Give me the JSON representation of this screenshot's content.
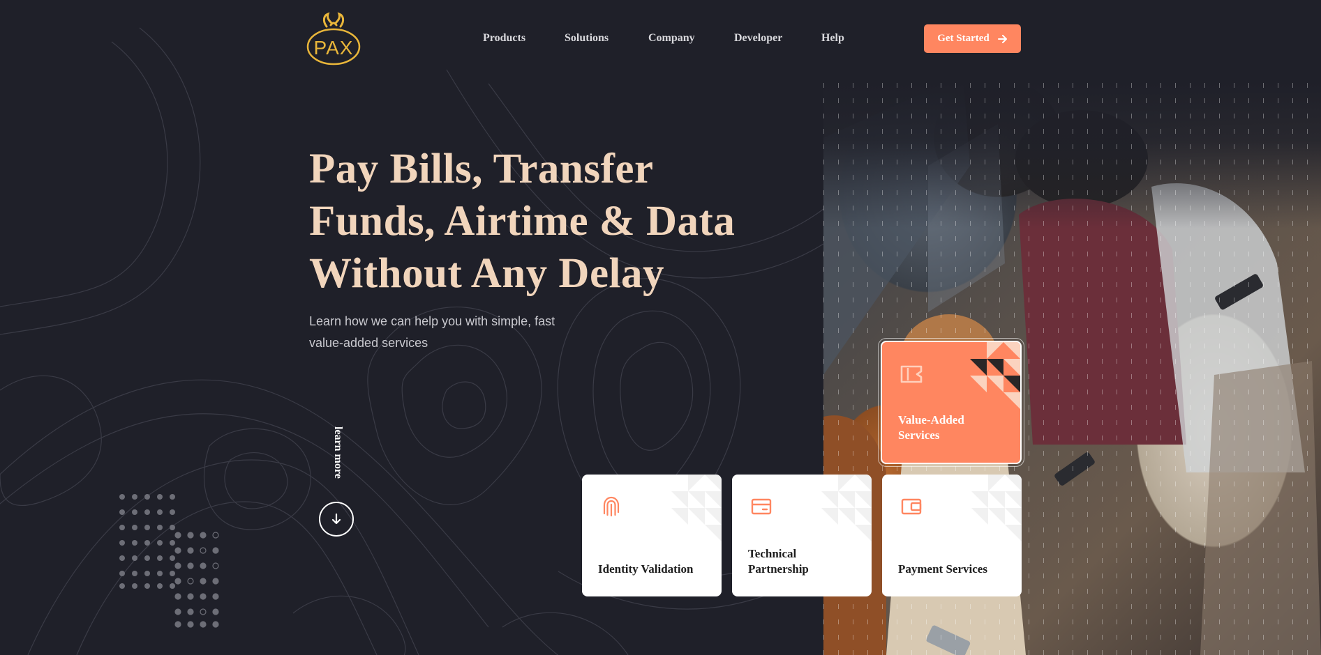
{
  "header": {
    "logo_text": "PAX",
    "nav": [
      "Products",
      "Solutions",
      "Company",
      "Developer",
      "Help"
    ],
    "cta_label": "Get Started"
  },
  "hero": {
    "title": "Pay Bills, Transfer Funds, Airtime & Data Without Any Delay",
    "subtitle": "Learn how we can help you with simple, fast value-added services",
    "learn_more": "learn more"
  },
  "cards": [
    {
      "label": "Value-Added Services",
      "icon": "ticket-icon",
      "featured": true
    },
    {
      "label": "Identity Validation",
      "icon": "fingerprint-icon",
      "featured": false
    },
    {
      "label": "Technical Partnership",
      "icon": "card-icon",
      "featured": false
    },
    {
      "label": "Payment Services",
      "icon": "wallet-icon",
      "featured": false
    }
  ],
  "colors": {
    "background": "#1f2029",
    "accent": "#ff8660",
    "headline": "#f1d5bc",
    "logo": "#e9b63a"
  }
}
